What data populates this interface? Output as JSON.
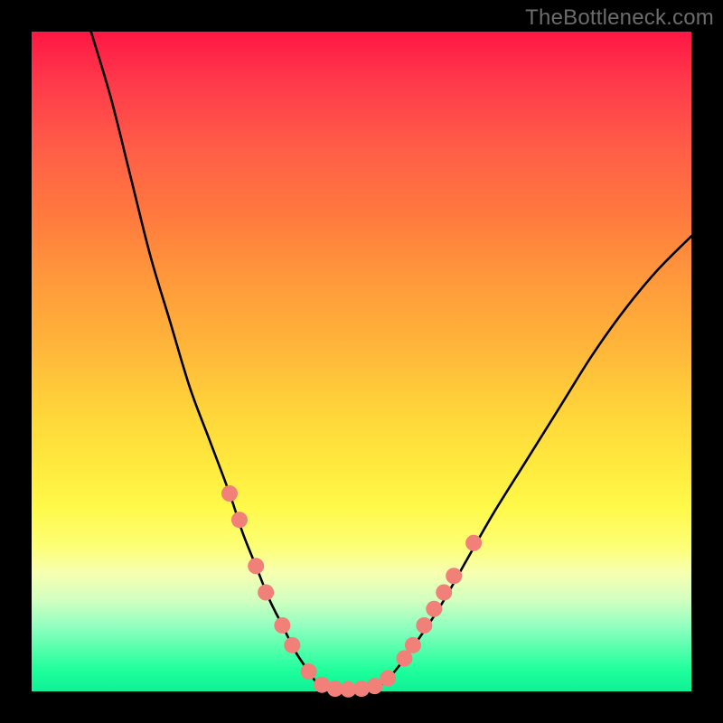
{
  "watermark": "TheBottleneck.com",
  "chart_data": {
    "type": "line",
    "title": "",
    "xlabel": "",
    "ylabel": "",
    "xlim": [
      0,
      100
    ],
    "ylim": [
      0,
      100
    ],
    "background_gradient": {
      "top": "#ff1744",
      "mid": "#ffe83a",
      "bottom": "#10f096"
    },
    "series": [
      {
        "name": "left-curve",
        "stroke": "#000000",
        "x": [
          9,
          12,
          15,
          18,
          21,
          24,
          27,
          30,
          32,
          34,
          36,
          38,
          40,
          42,
          43.5
        ],
        "y_pct": [
          100,
          90,
          78,
          66,
          56,
          46,
          38,
          30,
          24,
          19,
          14,
          10,
          6,
          3,
          1
        ]
      },
      {
        "name": "flat-bottom",
        "stroke": "#000000",
        "x": [
          43.5,
          45,
          47,
          49,
          51,
          53
        ],
        "y_pct": [
          1,
          0.5,
          0.3,
          0.3,
          0.5,
          1
        ]
      },
      {
        "name": "right-curve",
        "stroke": "#000000",
        "x": [
          53,
          55,
          58,
          62,
          66,
          70,
          75,
          80,
          85,
          90,
          95,
          100
        ],
        "y_pct": [
          1,
          3,
          7,
          13,
          20,
          27,
          35,
          43,
          51,
          58,
          64,
          69
        ]
      }
    ],
    "markers": {
      "name": "highlight-dots",
      "fill": "#f08078",
      "radius": 9,
      "points": [
        {
          "x": 30.0,
          "y_pct": 30
        },
        {
          "x": 31.5,
          "y_pct": 26
        },
        {
          "x": 34.0,
          "y_pct": 19
        },
        {
          "x": 35.5,
          "y_pct": 15
        },
        {
          "x": 38.0,
          "y_pct": 10
        },
        {
          "x": 39.5,
          "y_pct": 7
        },
        {
          "x": 42.0,
          "y_pct": 3
        },
        {
          "x": 44.0,
          "y_pct": 1
        },
        {
          "x": 46.0,
          "y_pct": 0.4
        },
        {
          "x": 48.0,
          "y_pct": 0.3
        },
        {
          "x": 50.0,
          "y_pct": 0.4
        },
        {
          "x": 52.0,
          "y_pct": 0.8
        },
        {
          "x": 54.0,
          "y_pct": 2
        },
        {
          "x": 56.5,
          "y_pct": 5
        },
        {
          "x": 57.8,
          "y_pct": 7
        },
        {
          "x": 59.5,
          "y_pct": 10
        },
        {
          "x": 61.0,
          "y_pct": 12.5
        },
        {
          "x": 62.5,
          "y_pct": 15
        },
        {
          "x": 64.0,
          "y_pct": 17.5
        },
        {
          "x": 67.0,
          "y_pct": 22.5
        }
      ]
    }
  }
}
